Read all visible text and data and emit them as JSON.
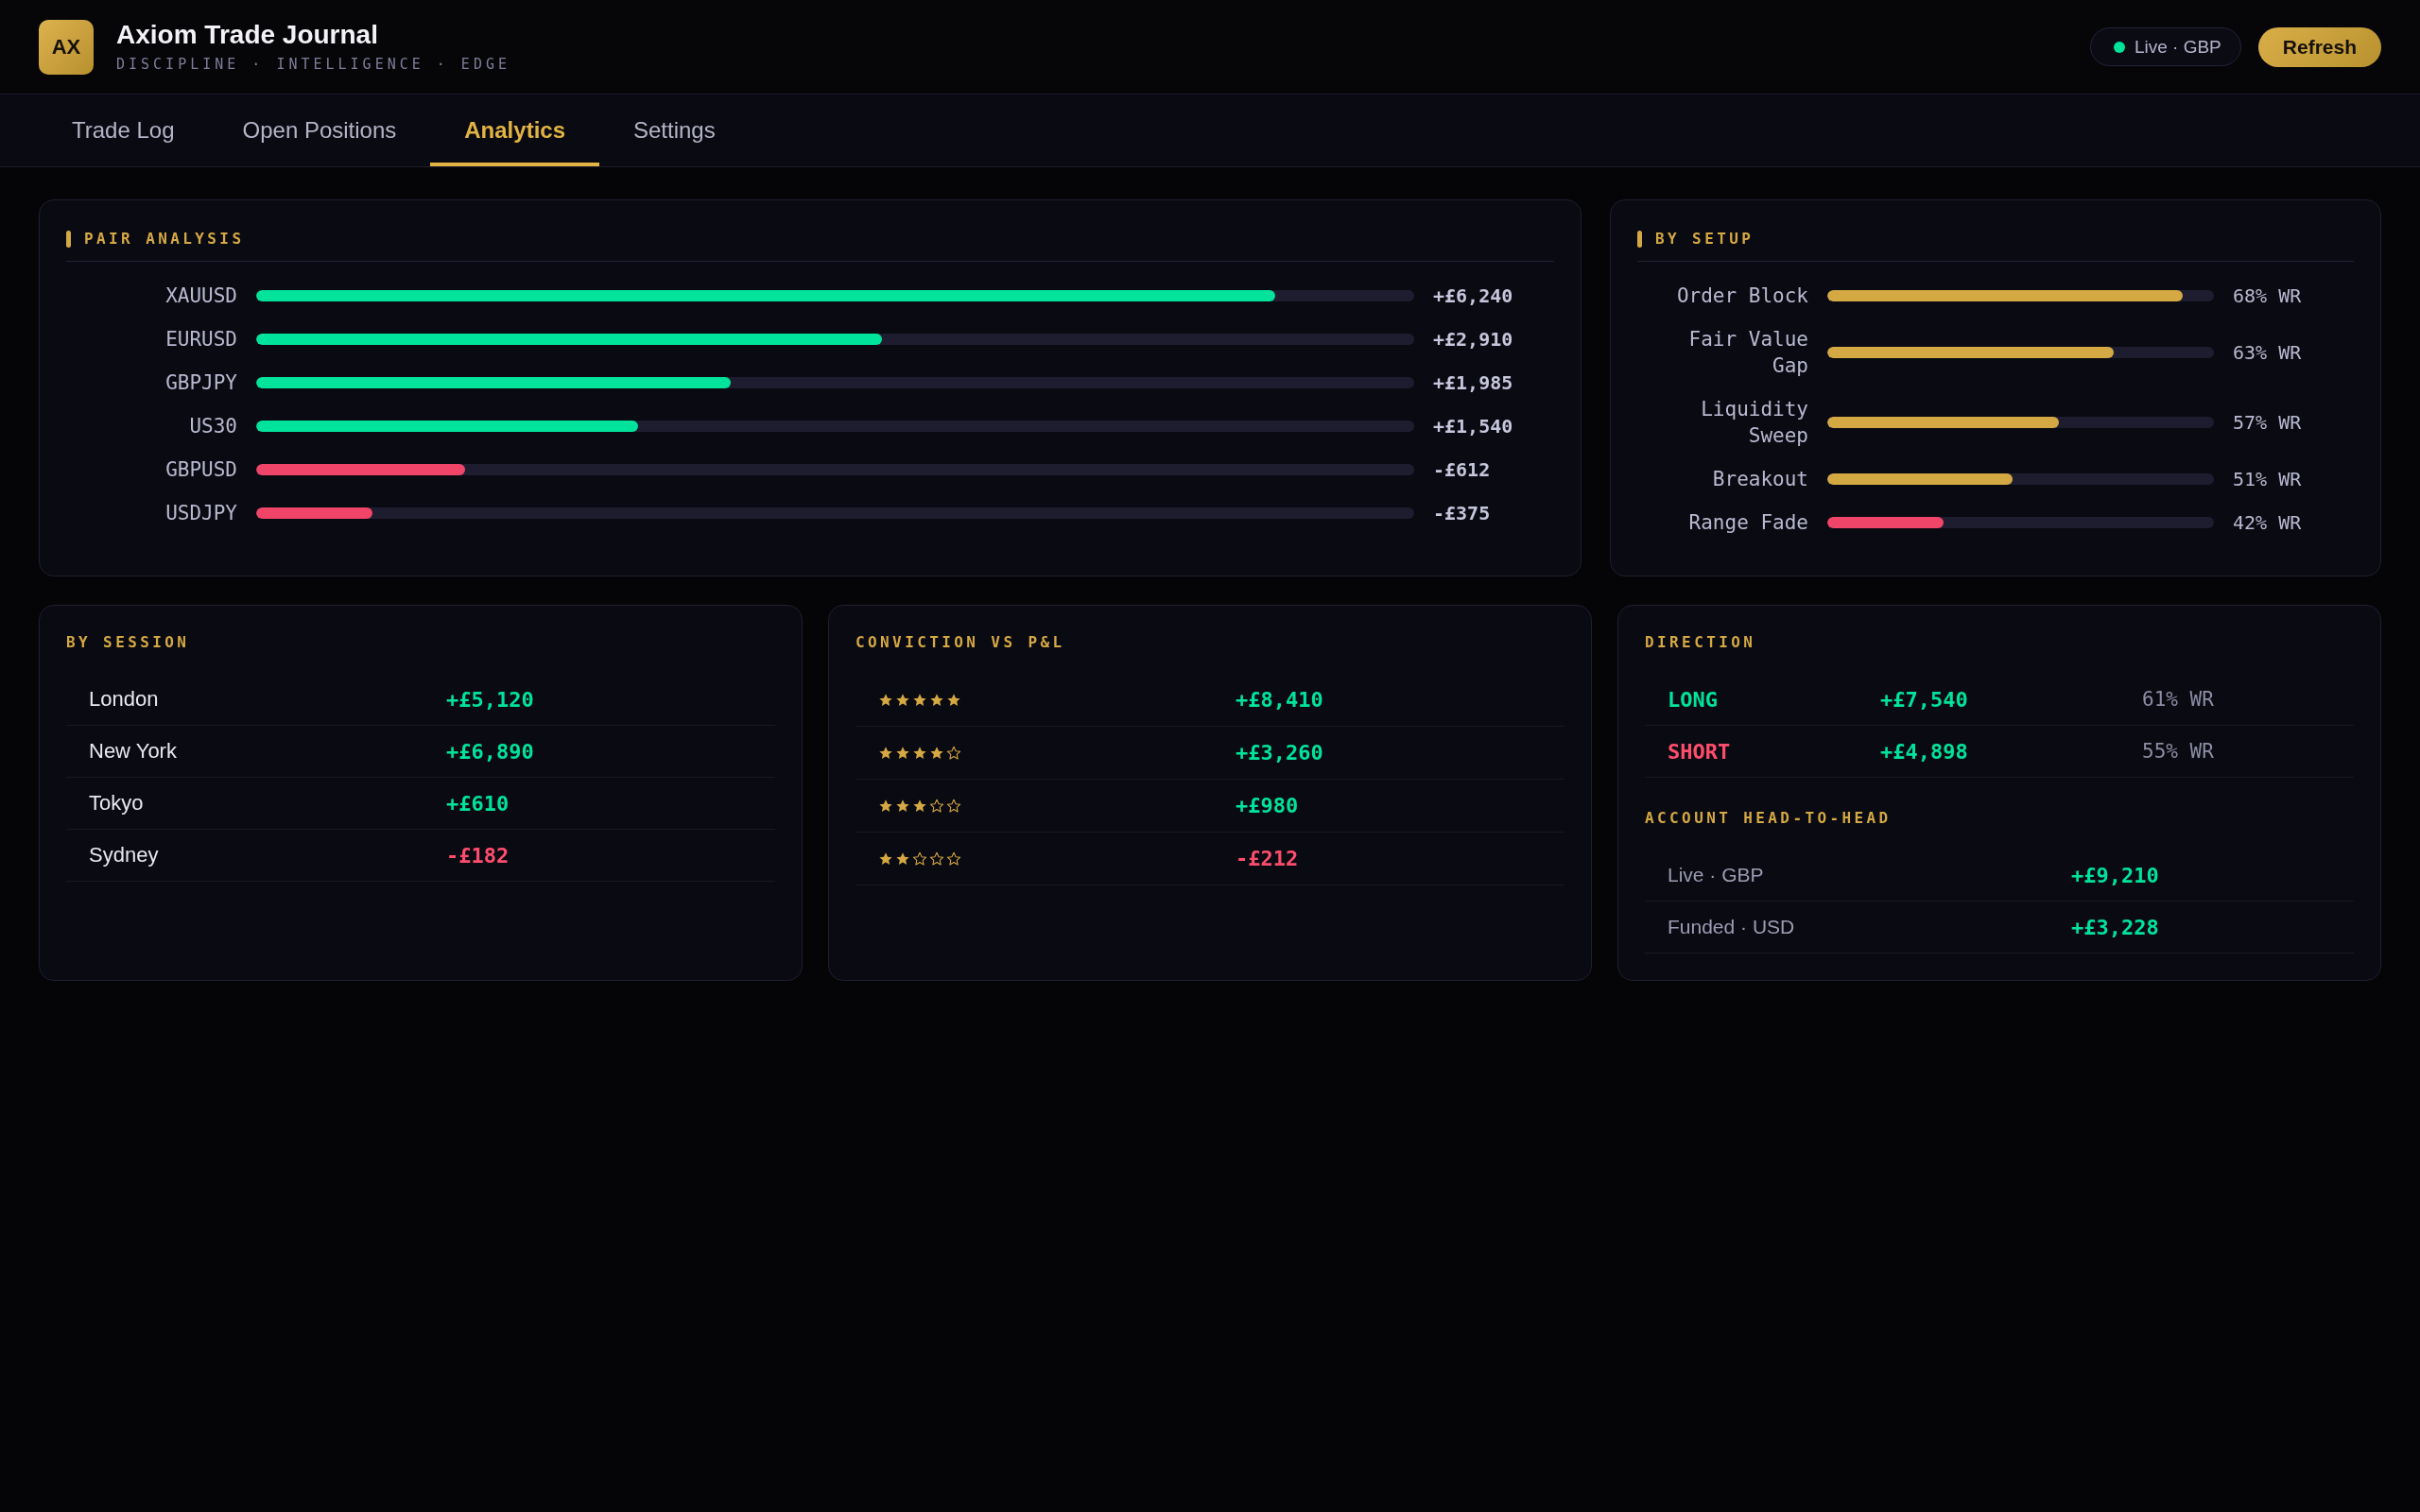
{
  "app": {
    "logo": "AX",
    "title": "Axiom Trade Journal",
    "tagline": "DISCIPLINE · INTELLIGENCE · EDGE"
  },
  "account_badge": {
    "label": "Live · GBP",
    "color": "#00e39a"
  },
  "refresh_button": "Refresh",
  "tabs": [
    {
      "label": "Trade Log",
      "selected": false
    },
    {
      "label": "Open Positions",
      "selected": false
    },
    {
      "label": "Analytics",
      "selected": true
    },
    {
      "label": "Settings",
      "selected": false
    }
  ],
  "pair_analysis": {
    "title": "PAIR ANALYSIS",
    "rows": [
      {
        "pair": "XAUUSD",
        "level": 0.88,
        "color": "#00e39a",
        "value": "+£6,240"
      },
      {
        "pair": "EURUSD",
        "level": 0.54,
        "color": "#00e39a",
        "value": "+£2,910"
      },
      {
        "pair": "GBPJPY",
        "level": 0.41,
        "color": "#00e39a",
        "value": "+£1,985"
      },
      {
        "pair": "US30",
        "level": 0.33,
        "color": "#00e39a",
        "value": "+£1,540"
      },
      {
        "pair": "GBPUSD",
        "level": 0.18,
        "color": "#f04468",
        "value": "-£612"
      },
      {
        "pair": "USDJPY",
        "level": 0.1,
        "color": "#f04468",
        "value": "-£375"
      }
    ]
  },
  "by_setup": {
    "title": "BY SETUP",
    "rows": [
      {
        "setup": "Order Block",
        "level": 0.92,
        "color": "#d4a843",
        "win_rate": "68% WR"
      },
      {
        "setup": "Fair Value Gap",
        "level": 0.74,
        "color": "#d4a843",
        "win_rate": "63% WR"
      },
      {
        "setup": "Liquidity Sweep",
        "level": 0.6,
        "color": "#d4a843",
        "win_rate": "57% WR"
      },
      {
        "setup": "Breakout",
        "level": 0.48,
        "color": "#d4a843",
        "win_rate": "51% WR"
      },
      {
        "setup": "Range Fade",
        "level": 0.3,
        "color": "#f04468",
        "win_rate": "42% WR"
      }
    ]
  },
  "by_session": {
    "title": "BY SESSION",
    "rows": [
      {
        "session": "London",
        "value": "+£5,120",
        "color": "#00e39a"
      },
      {
        "session": "New York",
        "value": "+£6,890",
        "color": "#00e39a"
      },
      {
        "session": "Tokyo",
        "value": "+£610",
        "color": "#00e39a"
      },
      {
        "session": "Sydney",
        "value": "-£182",
        "color": "#ff4d6d"
      }
    ]
  },
  "conviction": {
    "title": "CONVICTION VS P&L",
    "rows": [
      {
        "stars": 5,
        "value": "+£8,410",
        "color": "#00e39a"
      },
      {
        "stars": 4,
        "value": "+£3,260",
        "color": "#00e39a"
      },
      {
        "stars": 3,
        "value": "+£980",
        "color": "#00e39a"
      },
      {
        "stars": 2,
        "value": "-£212",
        "color": "#ff4d6d"
      }
    ]
  },
  "direction": {
    "title": "DIRECTION",
    "rows": [
      {
        "side": {
          "text": "LONG",
          "color": "#00e39a"
        },
        "pnl": {
          "text": "+£7,540",
          "color": "#00e39a"
        },
        "win_rate": "61% WR"
      },
      {
        "side": {
          "text": "SHORT",
          "color": "#ff4d6d"
        },
        "pnl": {
          "text": "+£4,898",
          "color": "#00e39a"
        },
        "win_rate": "55% WR"
      }
    ]
  },
  "account_head_to_head": {
    "title": "ACCOUNT HEAD-TO-HEAD",
    "rows": [
      {
        "account": "Live · GBP",
        "value": "+£9,210",
        "color": "#00e39a"
      },
      {
        "account": "Funded · USD",
        "value": "+£3,228",
        "color": "#00e39a"
      }
    ]
  }
}
